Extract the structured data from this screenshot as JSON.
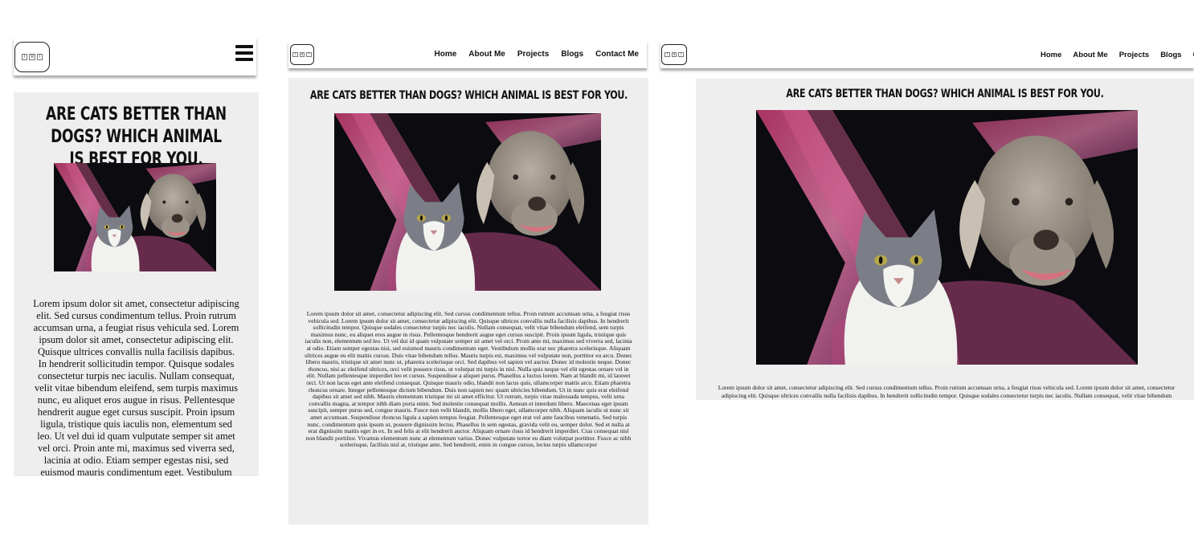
{
  "logo": {
    "glyphs": [
      "T",
      "W",
      "T"
    ]
  },
  "nav": {
    "items": [
      "Home",
      "About Me",
      "Projects",
      "Blogs",
      "Contact Me"
    ],
    "wide_truncated_last": "Co"
  },
  "menu_icon": "hamburger-icon",
  "article": {
    "title": "ARE CATS BETTER THAN DOGS? WHICH ANIMAL IS BEST FOR YOU.",
    "image": "cat-and-dog-photo",
    "body": "Lorem ipsum dolor sit amet, consectetur adipiscing elit. Sed cursus condimentum tellus. Proin rutrum accumsan urna, a feugiat risus vehicula sed. Lorem ipsum dolor sit amet, consectetur adipiscing elit. Quisque ultrices convallis nulla facilisis dapibus. In hendrerit sollicitudin tempor. Quisque sodales consectetur turpis nec iaculis. Nullam consequat, velit vitae bibendum eleifend, sem turpis maximus nunc, eu aliquet eros augue in risus. Pellentesque hendrerit augue eget cursus suscipit. Proin ipsum ligula, tristique quis iaculis non, elementum sed leo. Ut vel dui id quam vulputate semper sit amet vel orci. Proin ante mi, maximus sed viverra sed, lacinia at odio. Etiam semper egestas nisi, sed euismod mauris condimentum eget. Vestibulum mollis erat nec pharetra scelerisque. Aliquam ultrices augue eu elit mattis cursus. Duis vitae bibendum tellus. Mauris turpis est, maximus vel vulputate non, porttitor eu arcu. Donec libero mauris, tristique sit amet nunc ut, pharetra scelerisque orci. Sed dapibus vel sapien vel auctor. Donec id molestie neque. Donec rhoncus, nisi ac eleifend ultrices, orci velit posuere risus, ut volutpat mi turpis in nisl. Nulla quis neque vel elit egestas ornare vel in elit. Nullam pellentesque imperdiet leo et cursus. Suspendisse a aliquet purus. Phasellus a luctus lorem. Nam at blandit mi, id laoreet orci. Ut non lacus eget ante eleifend consequat. Quisque mauris odio, blandit non lacus quis, ullamcorper mattis arcu. Etiam pharetra rhoncus ornare. Integer pellentesque dictum bibendum. Duis non sapien nec quam ultricies bibendum. Ut in nunc quis erat eleifend dapibus sit amet sed nibh. Mauris elementum tristique mi sit amet efficitur. Ut rutrum, turpis vitae malesuada tempus, velit urna convallis magna, at tempor nibh diam porta enim. Sed molestie consequat mollis. Aenean et interdum libero. Maecenas eget ipsum suscipit, semper purus sed, congue mauris. Fusce non velit blandit, mollis libero eget, ullamcorper nibh. Aliquam iaculis ut nunc sit amet accumsan. Suspendisse rhoncus ligula a sapien tempus feugiat. Pellentesque eget erat vel ante faucibus venenatis. Sed turpis nunc, condimentum quis ipsum ut, posuere dignissim lectus. Phasellus in sem egestas, gravida velit eu, semper dolor. Sed et nulla at erat dignissim mattis eget in ex. In sed felis at elit hendrerit auctor. Aliquam ornare risus id hendrerit imperdiet. Cras consequat nisl non blandit porttitor. Vivamus elementum nunc at elementum varius. Donec vulputate tortor eu diam volutpat porttitor. Fusce ac nibh scelerisque, facilisis nisl at, tristique ante. Sed hendrerit, enim in congue cursus, lectus turpis ullamcorper"
  },
  "colors": {
    "card_bg": "#eeeeee",
    "text": "#111111",
    "header_bg": "#ffffff"
  }
}
